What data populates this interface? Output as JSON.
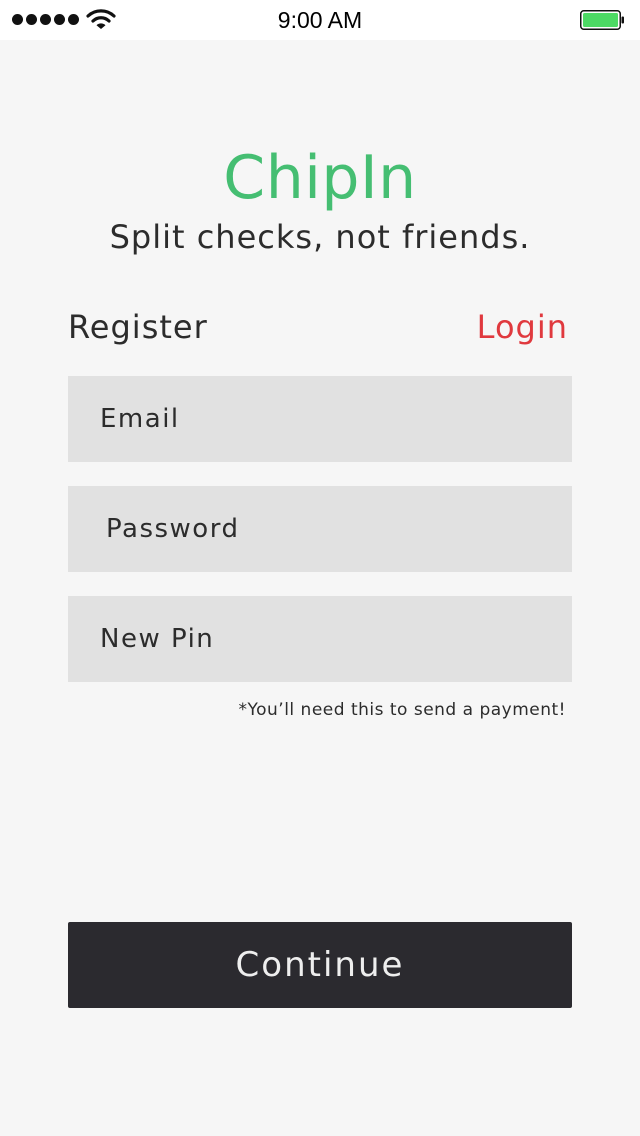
{
  "status_bar": {
    "time": "9:00 AM",
    "signal_icon": "cellular-signal-icon",
    "wifi_icon": "wifi-icon",
    "battery_icon": "battery-icon",
    "battery_color": "#4cd964"
  },
  "header": {
    "app_name": "ChipIn",
    "tagline": "Split checks, not friends."
  },
  "tabs": {
    "register_label": "Register",
    "login_label": "Login",
    "login_color": "#e0393e"
  },
  "form": {
    "email_placeholder": "Email",
    "password_placeholder": "Password",
    "pin_placeholder": "New Pin",
    "pin_hint": "*You’ll need this to send a payment!"
  },
  "actions": {
    "continue_label": "Continue"
  },
  "colors": {
    "brand_green": "#45be72",
    "dark": "#2b2a2f",
    "field_bg": "#e1e1e1",
    "page_bg": "#f6f6f6"
  }
}
